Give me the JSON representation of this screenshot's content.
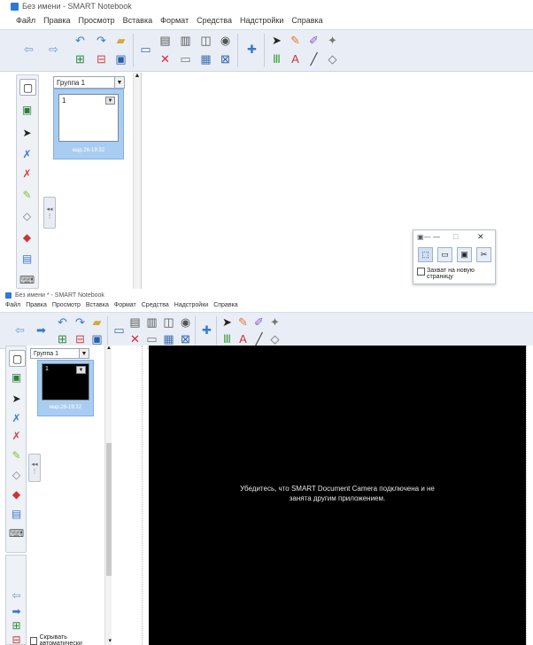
{
  "top_window": {
    "title": "Без имени - SMART Notebook",
    "menu": [
      "Файл",
      "Правка",
      "Просмотр",
      "Вставка",
      "Формат",
      "Средства",
      "Надстройки",
      "Справка"
    ],
    "group_label": "Группа 1",
    "page_number": "1",
    "page_date": "мар.26-19:32",
    "capture_dialog": {
      "minimize": "—",
      "maximize": "□",
      "close": "✕",
      "new_page_label": "Захват на новую страницу"
    }
  },
  "bottom_window": {
    "title": "Без имени * - SMART Notebook",
    "menu": [
      "Файл",
      "Правка",
      "Просмотр",
      "Вставка",
      "Формат",
      "Средства",
      "Надстройки",
      "Справка"
    ],
    "group_label": "Группа 1",
    "page_number": "1",
    "page_date": "мар.26-19:32",
    "camera_message": "Убедитесь, что SMART Document Camera подключена и не занята другим приложением.",
    "auto_hide_label": "Скрывать автоматически"
  },
  "colors": {
    "toolbar_bg": "#e9eef6",
    "thumb_selected": "#a9cdf2",
    "accent_blue": "#2b7ad6",
    "camera_bg": "#000000"
  }
}
